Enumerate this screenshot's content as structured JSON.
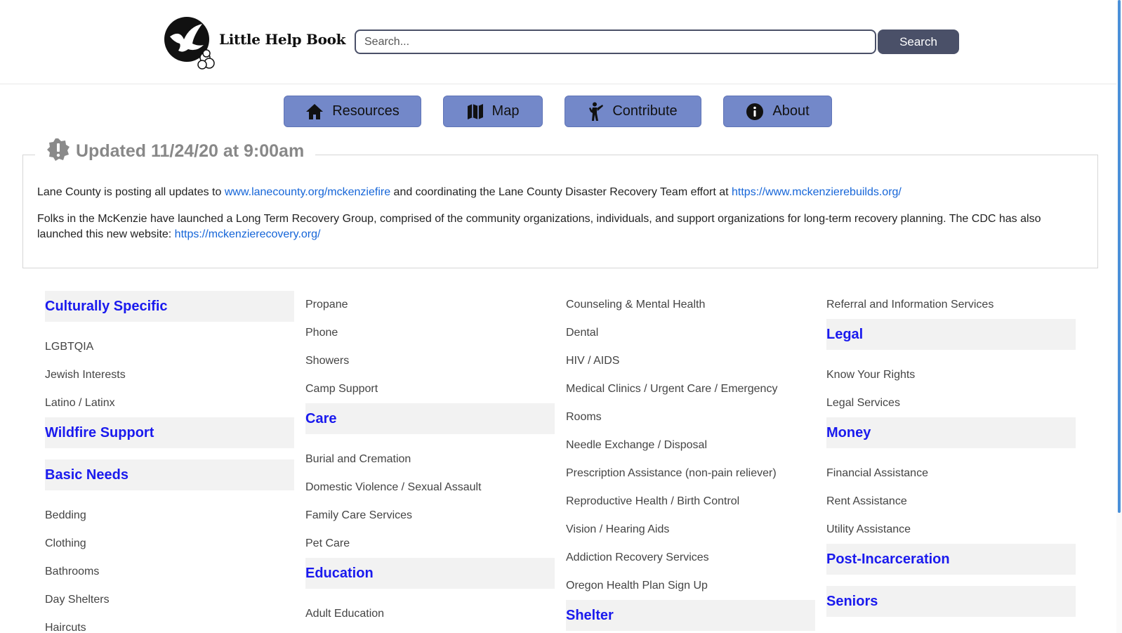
{
  "header": {
    "logo_text": "Little Help Book",
    "search_placeholder": "Search...",
    "search_label": "Search"
  },
  "nav": [
    {
      "label": "Resources",
      "icon": "home-icon"
    },
    {
      "label": "Map",
      "icon": "map-icon"
    },
    {
      "label": "Contribute",
      "icon": "person-icon"
    },
    {
      "label": "About",
      "icon": "info-icon"
    }
  ],
  "alert": {
    "title": "Updated 11/24/20 at 9:00am",
    "icon": "alert-badge-icon",
    "p1_before": "Lane County is posting all updates to ",
    "p1_link1": "www.lanecounty.org/mckenziefire",
    "p1_middle": " and coordinating the Lane County Disaster Recovery Team effort at ",
    "p1_link2": "https://www.mckenzierebuilds.org/",
    "p2_before": "Folks in the McKenzie have launched a Long Term Recovery Group, comprised of the community organizations, individuals, and support organizations for long-term recovery planning. The CDC has also launched this new website: ",
    "p2_link": "https://mckenzierecovery.org/"
  },
  "columns": [
    [
      {
        "type": "cat",
        "label": "Culturally Specific"
      },
      {
        "type": "sub",
        "label": "LGBTQIA"
      },
      {
        "type": "sub",
        "label": "Jewish Interests"
      },
      {
        "type": "sub",
        "label": "Latino / Latinx"
      },
      {
        "type": "cat",
        "label": "Wildfire Support"
      },
      {
        "type": "cat",
        "label": "Basic Needs"
      },
      {
        "type": "sub",
        "label": "Bedding"
      },
      {
        "type": "sub",
        "label": "Clothing"
      },
      {
        "type": "sub",
        "label": "Bathrooms"
      },
      {
        "type": "sub",
        "label": "Day Shelters"
      },
      {
        "type": "sub",
        "label": "Haircuts"
      }
    ],
    [
      {
        "type": "sub",
        "label": "Propane"
      },
      {
        "type": "sub",
        "label": "Phone"
      },
      {
        "type": "sub",
        "label": "Showers"
      },
      {
        "type": "sub",
        "label": "Camp Support"
      },
      {
        "type": "cat",
        "label": "Care"
      },
      {
        "type": "sub",
        "label": "Burial and Cremation"
      },
      {
        "type": "sub",
        "label": "Domestic Violence / Sexual Assault"
      },
      {
        "type": "sub",
        "label": "Family Care Services"
      },
      {
        "type": "sub",
        "label": "Pet Care"
      },
      {
        "type": "cat",
        "label": "Education"
      },
      {
        "type": "sub",
        "label": "Adult Education"
      }
    ],
    [
      {
        "type": "sub",
        "label": "Counseling & Mental Health"
      },
      {
        "type": "sub",
        "label": "Dental"
      },
      {
        "type": "sub",
        "label": "HIV / AIDS"
      },
      {
        "type": "sub",
        "label": "Medical Clinics / Urgent Care / Emergency"
      },
      {
        "type": "sub",
        "label": "Rooms"
      },
      {
        "type": "sub",
        "label": "Needle Exchange / Disposal"
      },
      {
        "type": "sub",
        "label": "Prescription Assistance (non-pain reliever)"
      },
      {
        "type": "sub",
        "label": "Reproductive Health / Birth Control"
      },
      {
        "type": "sub",
        "label": "Vision / Hearing Aids"
      },
      {
        "type": "sub",
        "label": "Addiction Recovery Services"
      },
      {
        "type": "sub",
        "label": "Oregon Health Plan Sign Up"
      },
      {
        "type": "cat",
        "label": "Shelter"
      }
    ],
    [
      {
        "type": "sub",
        "label": "Referral and Information Services"
      },
      {
        "type": "cat",
        "label": "Legal"
      },
      {
        "type": "sub",
        "label": "Know Your Rights"
      },
      {
        "type": "sub",
        "label": "Legal Services"
      },
      {
        "type": "cat",
        "label": "Money"
      },
      {
        "type": "sub",
        "label": "Financial Assistance"
      },
      {
        "type": "sub",
        "label": "Rent Assistance"
      },
      {
        "type": "sub",
        "label": "Utility Assistance"
      },
      {
        "type": "cat",
        "label": "Post-Incarceration"
      },
      {
        "type": "cat",
        "label": "Seniors"
      }
    ]
  ]
}
